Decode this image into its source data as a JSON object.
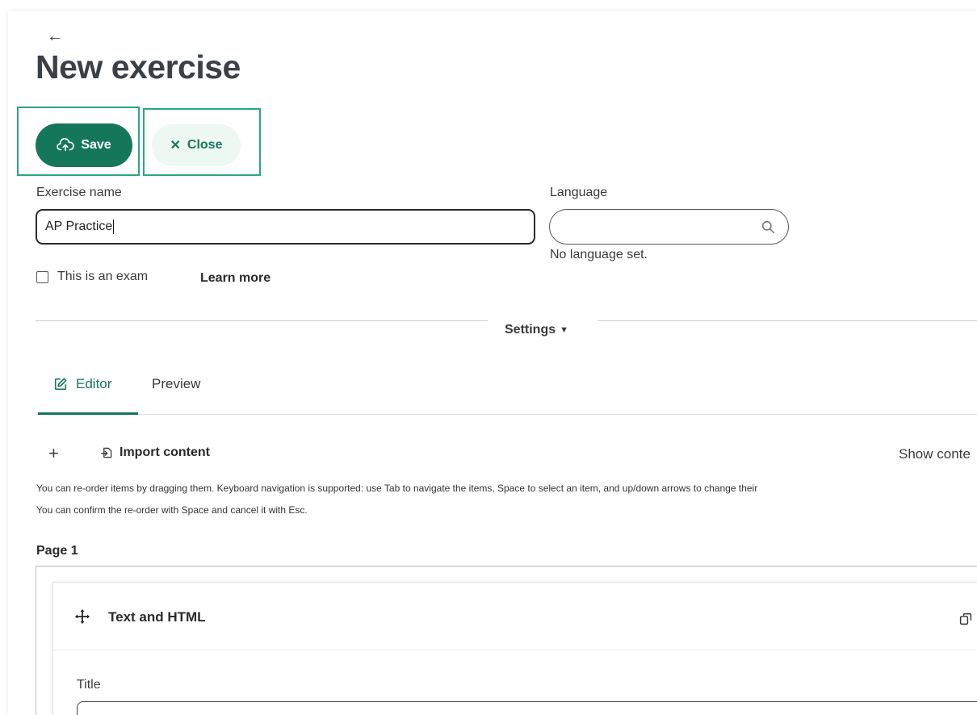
{
  "header": {
    "title": "New exercise"
  },
  "toolbar": {
    "save_label": "Save",
    "close_label": "Close"
  },
  "form": {
    "exercise_name_label": "Exercise name",
    "exercise_name_value": "AP Practice",
    "language_label": "Language",
    "language_value": "",
    "language_status": "No language set.",
    "exam_checkbox_label": "This is an exam",
    "exam_checked": false,
    "learn_more": "Learn more"
  },
  "settings_label": "Settings",
  "tabs": [
    {
      "label": "Editor",
      "active": true
    },
    {
      "label": "Preview",
      "active": false
    }
  ],
  "content_toolbar": {
    "import_label": "Import content",
    "show_label": "Show conte"
  },
  "instructions": {
    "line1": "You can re-order items by dragging them. Keyboard navigation is supported: use Tab to navigate the items, Space to select an item, and up/down arrows to change their",
    "line2": "You can confirm the re-order with Space and cancel it with Esc."
  },
  "page": {
    "label": "Page 1",
    "item_title": "Text and HTML",
    "field_title_label": "Title"
  },
  "colors": {
    "primary": "#15775a",
    "highlight": "#2aa77b",
    "close_bg": "#eef8f3",
    "title": "#3a4046"
  }
}
